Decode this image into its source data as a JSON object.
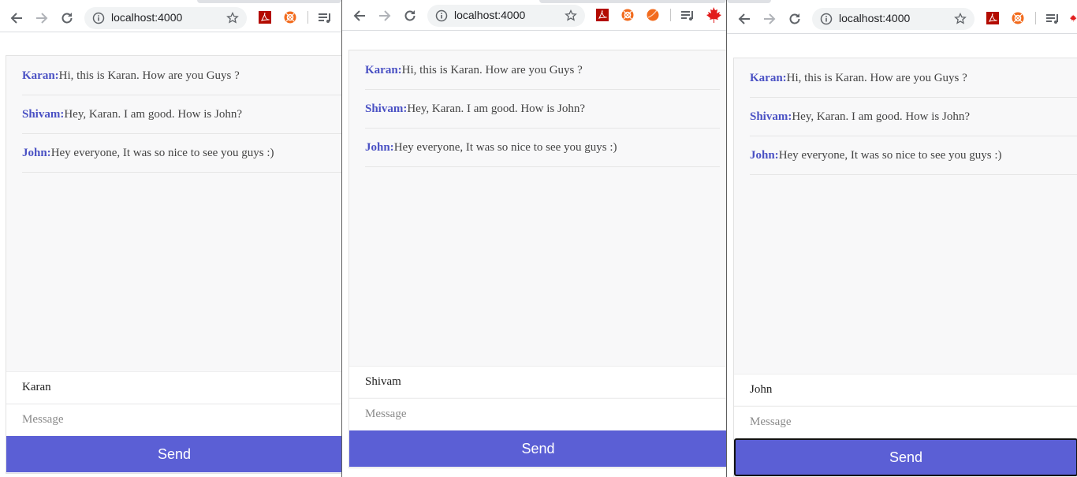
{
  "browser": {
    "url": "localhost:4000",
    "extensions": [
      "pdf-icon",
      "orange-circle-icon",
      "orange-ball-icon",
      "playlist-icon",
      "maple-leaf-icon"
    ]
  },
  "colors": {
    "accent": "#5b5fd5",
    "sender": "#4a51c4",
    "pdf": "#b30b00",
    "orange": "#f26b1d",
    "maple": "#e21b1b"
  },
  "windows": [
    {
      "messages": [
        {
          "sender": "Karan:",
          "text": "Hi, this is Karan. How are you Guys ?"
        },
        {
          "sender": "Shivam:",
          "text": "Hey, Karan. I am good. How is John?"
        },
        {
          "sender": "John:",
          "text": "Hey everyone, It was so nice to see you guys :)"
        }
      ],
      "name_value": "Karan",
      "message_placeholder": "Message",
      "send_label": "Send"
    },
    {
      "messages": [
        {
          "sender": "Karan:",
          "text": "Hi, this is Karan. How are you Guys ?"
        },
        {
          "sender": "Shivam:",
          "text": "Hey, Karan. I am good. How is John?"
        },
        {
          "sender": "John:",
          "text": "Hey everyone, It was so nice to see you guys :)"
        }
      ],
      "name_value": "Shivam",
      "message_placeholder": "Message",
      "send_label": "Send"
    },
    {
      "messages": [
        {
          "sender": "Karan:",
          "text": "Hi, this is Karan. How are you Guys ?"
        },
        {
          "sender": "Shivam:",
          "text": "Hey, Karan. I am good. How is John?"
        },
        {
          "sender": "John:",
          "text": "Hey everyone, It was so nice to see you guys :)"
        }
      ],
      "name_value": "John",
      "message_placeholder": "Message",
      "send_label": "Send"
    }
  ]
}
